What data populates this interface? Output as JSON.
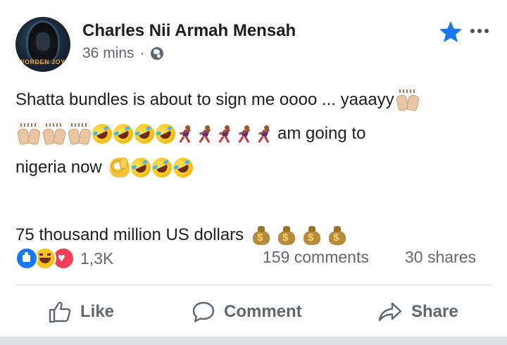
{
  "post": {
    "author": "Charles Nii Armah Mensah",
    "time": "36 mins",
    "separator": "·",
    "avatar_text": "WORDEN JOY",
    "lines": {
      "l1": "Shatta bundles is about to sign me oooo ... yaaayy",
      "l2": "am going to",
      "l3": "nigeria now",
      "l5": "75 thousand million US dollars"
    },
    "icons": {
      "audience": "globe-icon",
      "favorite": "star-icon",
      "menu": "more-options-icon"
    }
  },
  "stats": {
    "reactions_count": "1,3K",
    "comments": "159 comments",
    "shares": "30 shares",
    "reactions": [
      "like",
      "haha",
      "love"
    ]
  },
  "actions": {
    "like": "Like",
    "comment": "Comment",
    "share": "Share"
  },
  "colors": {
    "accent": "#1877f2",
    "text": "#1c1e21",
    "secondary": "#616770"
  }
}
